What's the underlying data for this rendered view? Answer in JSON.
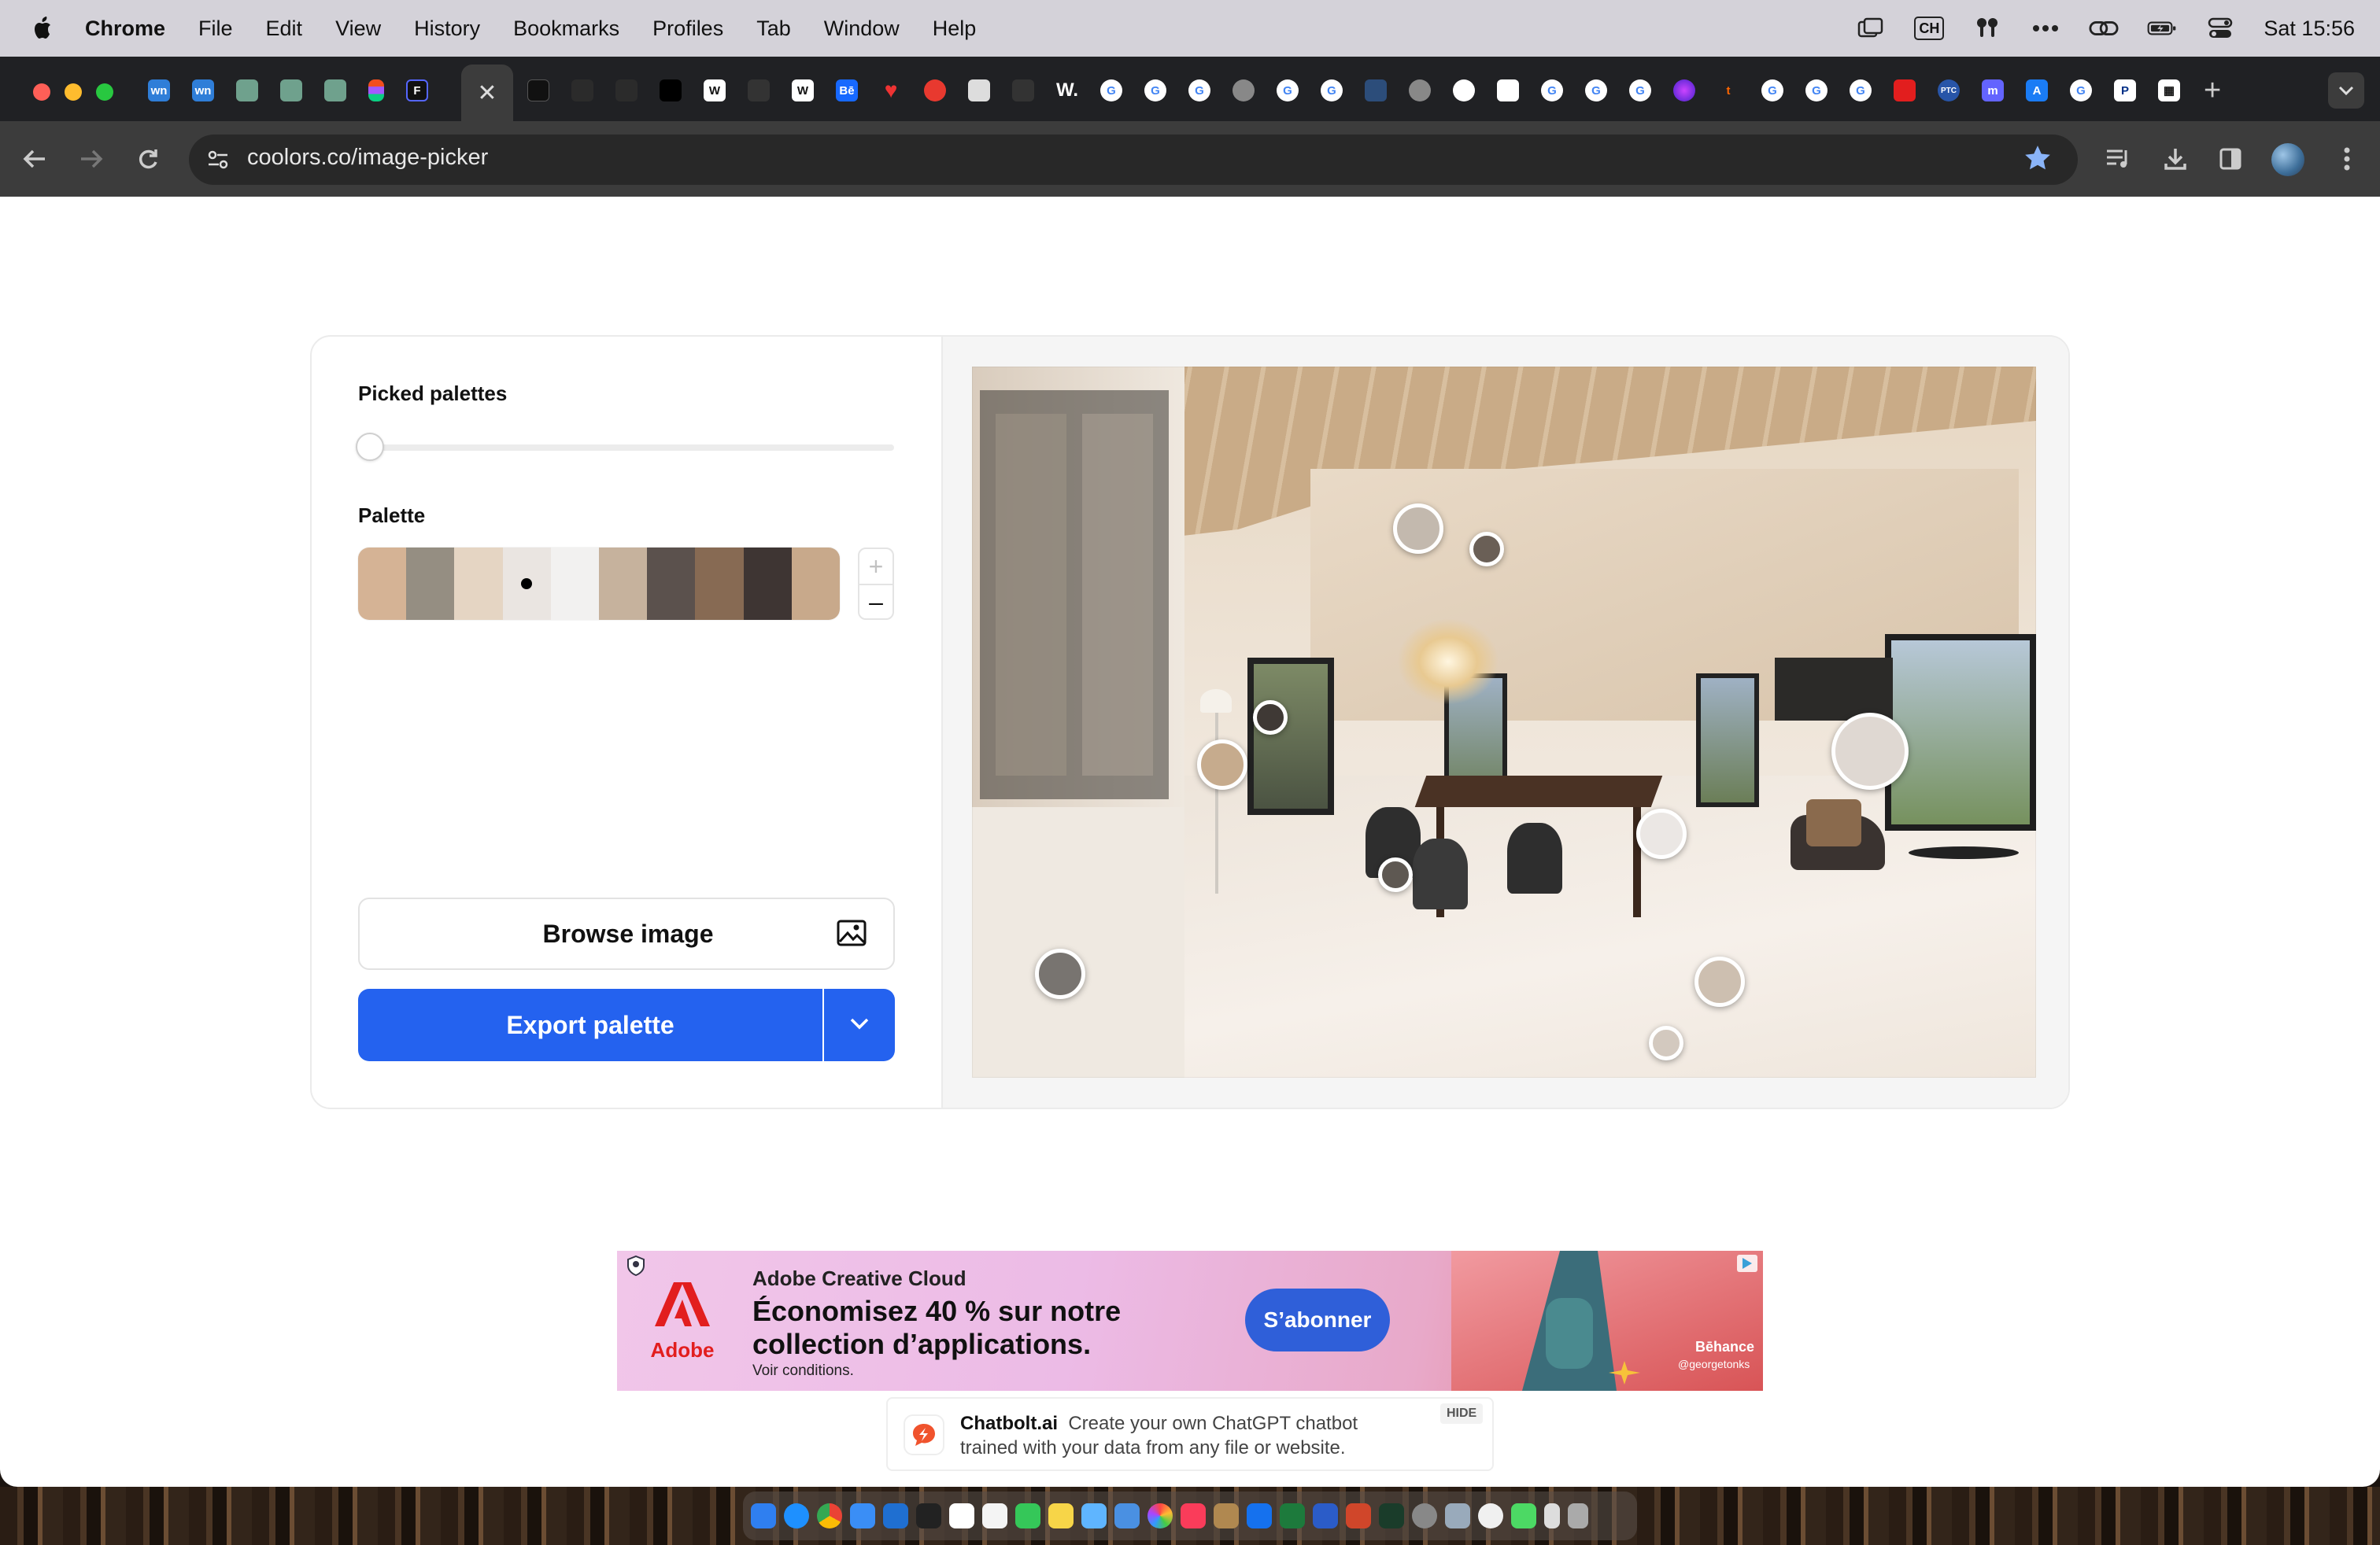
{
  "menubar": {
    "app": "Chrome",
    "items": [
      "File",
      "Edit",
      "View",
      "History",
      "Bookmarks",
      "Profiles",
      "Tab",
      "Window",
      "Help"
    ],
    "input_source": "CH",
    "clock": "Sat 15:56"
  },
  "browser": {
    "url": "coolors.co/image-picker",
    "tab_favicons": [
      "wordpress-icon",
      "wordpress-icon",
      "openai-icon",
      "openai-icon",
      "openai-icon",
      "figma-icon",
      "framer-icon",
      "active-tab-close",
      "notion-icon",
      "pen-icon",
      "ink-icon",
      "site-icon",
      "wikipedia-icon",
      "swoosh-icon",
      "wikipedia-icon",
      "behance-icon",
      "heart-icon",
      "record-icon",
      "screenshot-icon",
      "dash-icon",
      "webflow-icon",
      "google-icon",
      "google-icon",
      "google-icon",
      "globe-icon",
      "google-icon",
      "google-icon",
      "tree-icon",
      "globe-icon",
      "openai-icon",
      "notion-icon",
      "google-icon",
      "google-icon",
      "google-icon",
      "orb-icon",
      "tumblr-icon",
      "google-icon",
      "google-icon",
      "google-icon",
      "adobe-icon",
      "ptc-icon",
      "mastodon-icon",
      "appstore-icon",
      "google-icon",
      "paypal-icon",
      "qr-icon"
    ],
    "tab_letters": {
      "wn": "wn",
      "w": "W.",
      "be": "Bē",
      "ptc": "PTC"
    }
  },
  "picker": {
    "picked_label": "Picked palettes",
    "palette_label": "Palette",
    "palette_swatches": [
      "#d5b395",
      "#958e82",
      "#e5d5c3",
      "#eae5e1",
      "#f2f1f0",
      "#c6b29d",
      "#5b514d",
      "#876a53",
      "#3e3533",
      "#c8a98b"
    ],
    "selected_swatch_index": 3,
    "plus_label": "+",
    "minus_label": "–",
    "browse_label": "Browse image",
    "export_label": "Export palette",
    "picker_colors": [
      "#c3b9ae",
      "#6a5f56",
      "#3f3935",
      "#c6ab8d",
      "#5e5852",
      "#ebe7e4",
      "#dfd8d2",
      "#787470",
      "#cdbfb0",
      "#d3c9bf"
    ]
  },
  "ad": {
    "brand": "Adobe Creative Cloud",
    "headline": "Économisez 40 % sur notre collection d’applications.",
    "conditions": "Voir conditions.",
    "cta": "S’abonner",
    "logo_text": "Adobe",
    "behance": "Bēhance",
    "credit": "@georgetonks"
  },
  "chatbolt": {
    "name": "Chatbolt.ai",
    "text": "Create your own ChatGPT chatbot trained with your data from any file or website.",
    "hide": "HIDE"
  }
}
